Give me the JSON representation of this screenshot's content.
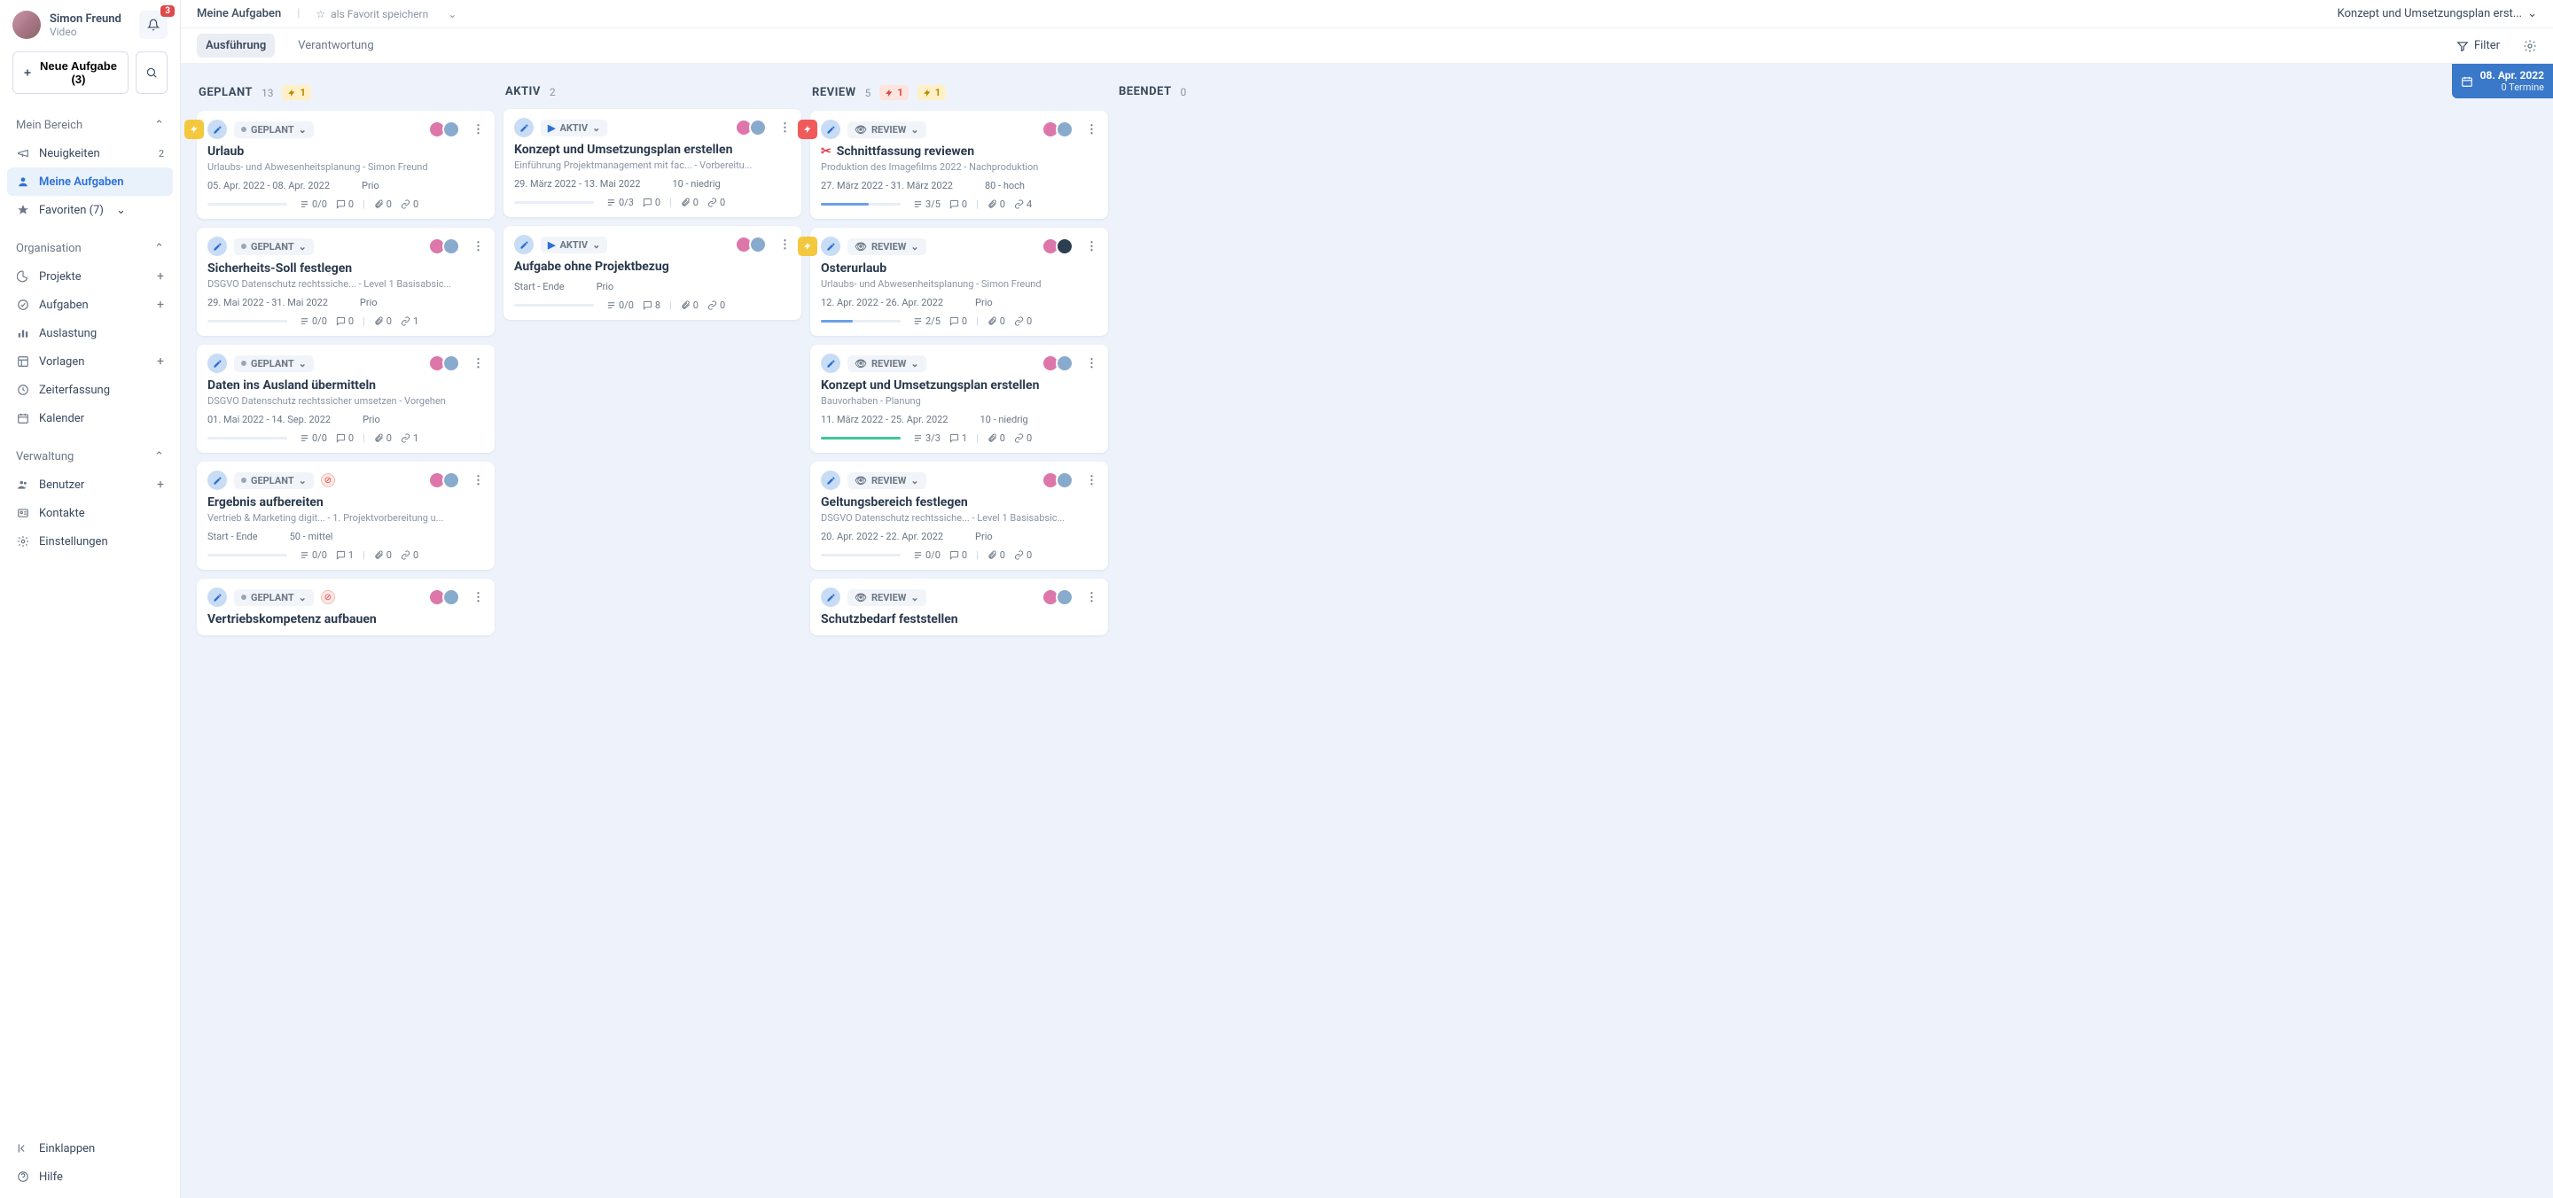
{
  "user": {
    "name": "Simon Freund",
    "sub": "Video",
    "notifications": "3"
  },
  "sidebar": {
    "newTask": "Neue Aufgabe (3)",
    "sections": {
      "myArea": "Mein Bereich",
      "organisation": "Organisation",
      "verwaltung": "Verwaltung"
    },
    "news": {
      "label": "Neuigkeiten",
      "count": "2"
    },
    "myTasks": "Meine Aufgaben",
    "favorites": "Favoriten (7)",
    "projects": "Projekte",
    "tasks": "Aufgaben",
    "workload": "Auslastung",
    "templates": "Vorlagen",
    "timeTracking": "Zeiterfassung",
    "calendar": "Kalender",
    "users": "Benutzer",
    "contacts": "Kontakte",
    "settings": "Einstellungen",
    "collapse": "Einklappen",
    "help": "Hilfe"
  },
  "topbar": {
    "crumb": "Meine Aufgaben",
    "favSave": "als Favorit speichern",
    "selectedTask": "Konzept und Umsetzungsplan erst...",
    "filter": "Filter"
  },
  "tabs": {
    "execution": "Ausführung",
    "responsibility": "Verantwortung"
  },
  "dateBadge": {
    "date": "08. Apr. 2022",
    "sub": "0 Termine"
  },
  "columns": {
    "geplant": {
      "title": "GEPLANT",
      "count": "13",
      "badges": [
        {
          "kind": "yellow",
          "icon": "bolt",
          "val": "1"
        }
      ]
    },
    "aktiv": {
      "title": "AKTIV",
      "count": "2",
      "badges": []
    },
    "review": {
      "title": "REVIEW",
      "count": "5",
      "badges": [
        {
          "kind": "red",
          "icon": "bolt",
          "val": "1"
        },
        {
          "kind": "yellow",
          "icon": "bolt",
          "val": "1"
        }
      ]
    },
    "beendet": {
      "title": "BEENDET",
      "count": "0",
      "badges": []
    }
  },
  "cards": {
    "geplant": [
      {
        "indicator": "yellow",
        "status": "GEPLANT",
        "title": "Urlaub",
        "sub": "Urlaubs- und Abwesenheitsplanung - Simon Freund",
        "dates": "05. Apr. 2022 - 08. Apr. 2022",
        "prio": "Prio",
        "progressPct": 0,
        "progressColor": "blue",
        "checklist": "0/0",
        "comments": "0",
        "attachments": "0",
        "links": "0"
      },
      {
        "status": "GEPLANT",
        "title": "Sicherheits-Soll festlegen",
        "sub": "DSGVO Datenschutz rechtssiche...  - Level 1 Basisabsic...",
        "dates": "29. Mai 2022 - 31. Mai 2022",
        "prio": "Prio",
        "progressPct": 0,
        "progressColor": "blue",
        "checklist": "0/0",
        "comments": "0",
        "attachments": "0",
        "links": "1"
      },
      {
        "status": "GEPLANT",
        "title": "Daten ins Ausland übermitteln",
        "sub": "DSGVO Datenschutz rechtssicher umsetzen - Vorgehen",
        "dates": "01. Mai 2022 - 14. Sep. 2022",
        "prio": "Prio",
        "progressPct": 0,
        "progressColor": "blue",
        "checklist": "0/0",
        "comments": "0",
        "attachments": "0",
        "links": "1"
      },
      {
        "status": "GEPLANT",
        "extraChip": true,
        "title": "Ergebnis aufbereiten",
        "sub": "Vertrieb & Marketing digit... - 1. Projektvorbereitung u...",
        "dates": "Start - Ende",
        "prio": "50 - mittel",
        "progressPct": 0,
        "progressColor": "blue",
        "checklist": "0/0",
        "comments": "1",
        "attachments": "0",
        "links": "0"
      },
      {
        "status": "GEPLANT",
        "extraChip": true,
        "title": "Vertriebskompetenz aufbauen",
        "sub": "",
        "dates": "",
        "prio": "",
        "progressPct": 0,
        "progressColor": "blue",
        "checklist": "",
        "comments": "",
        "attachments": "",
        "links": "",
        "partial": true
      }
    ],
    "aktiv": [
      {
        "status": "AKTIV",
        "title": "Konzept und Umsetzungsplan erstellen",
        "sub": "Einführung Projektmanagement mit fac...  - Vorbereitu...",
        "dates": "29. März 2022 - 13. Mai 2022",
        "prio": "10 - niedrig",
        "progressPct": 0,
        "progressColor": "blue",
        "checklist": "0/3",
        "comments": "0",
        "attachments": "0",
        "links": "0"
      },
      {
        "status": "AKTIV",
        "title": "Aufgabe ohne Projektbezug",
        "sub": "",
        "dates": "Start - Ende",
        "prio": "Prio",
        "progressPct": 0,
        "progressColor": "blue",
        "checklist": "0/0",
        "comments": "8",
        "attachments": "0",
        "links": "0"
      }
    ],
    "review": [
      {
        "indicator": "red",
        "status": "REVIEW",
        "titleIcon": "scissors",
        "title": "Schnittfassung reviewen",
        "sub": "Produktion des Imagefilms 2022 - Nachproduktion",
        "dates": "27. März 2022 - 31. März 2022",
        "prio": "80 - hoch",
        "progressPct": 60,
        "progressColor": "blue",
        "checklist": "3/5",
        "comments": "0",
        "attachments": "0",
        "links": "4"
      },
      {
        "indicator": "yellow",
        "status": "REVIEW",
        "title": "Osterurlaub",
        "sub": "Urlaubs- und Abwesenheitsplanung - Simon Freund",
        "dates": "12. Apr. 2022 - 26. Apr. 2022",
        "prio": "Prio",
        "progressPct": 40,
        "progressColor": "blue",
        "checklist": "2/5",
        "comments": "0",
        "attachments": "0",
        "links": "0",
        "darkAvatar": true
      },
      {
        "status": "REVIEW",
        "title": "Konzept und Umsetzungsplan erstellen",
        "sub": "Bauvorhaben - Planung",
        "dates": "11. März 2022 - 25. Apr. 2022",
        "prio": "10 - niedrig",
        "progressPct": 100,
        "progressColor": "green",
        "checklist": "3/3",
        "comments": "1",
        "attachments": "0",
        "links": "0"
      },
      {
        "status": "REVIEW",
        "title": "Geltungsbereich festlegen",
        "sub": "DSGVO Datenschutz rechtssiche...  - Level 1 Basisabsic...",
        "dates": "20. Apr. 2022 - 22. Apr. 2022",
        "prio": "Prio",
        "progressPct": 0,
        "progressColor": "blue",
        "checklist": "0/0",
        "comments": "0",
        "attachments": "0",
        "links": "0"
      },
      {
        "status": "REVIEW",
        "title": "Schutzbedarf feststellen",
        "sub": "",
        "dates": "",
        "prio": "",
        "progressPct": 0,
        "progressColor": "blue",
        "checklist": "",
        "comments": "",
        "attachments": "",
        "links": "",
        "partial": true
      }
    ]
  }
}
